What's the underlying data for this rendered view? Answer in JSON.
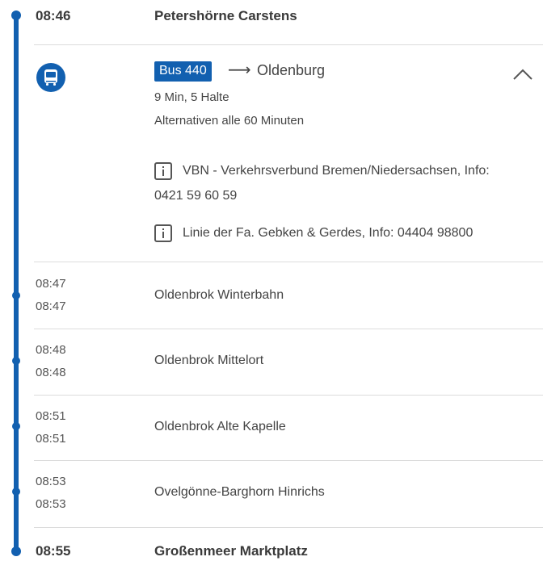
{
  "departure": {
    "time": "08:46",
    "station": "Petershörne Carstens"
  },
  "leg": {
    "icon": "bus-icon",
    "line": "Bus 440",
    "direction": "Oldenburg",
    "duration": "9 Min, 5 Halte",
    "alternatives": "Alternativen alle 60 Minuten",
    "notes": [
      {
        "icon": "info-icon",
        "line1": "VBN - Verkehrsverbund Bremen/Niedersachsen, Info:",
        "line2": "0421 59 60 59"
      },
      {
        "icon": "info-icon",
        "line1": "Linie der Fa. Gebken & Gerdes, Info: 04404 98800"
      }
    ]
  },
  "stops": [
    {
      "arr": "08:47",
      "dep": "08:47",
      "name": "Oldenbrok Winterbahn"
    },
    {
      "arr": "08:48",
      "dep": "08:48",
      "name": "Oldenbrok Mittelort"
    },
    {
      "arr": "08:51",
      "dep": "08:51",
      "name": "Oldenbrok Alte Kapelle"
    },
    {
      "arr": "08:53",
      "dep": "08:53",
      "name": "Ovelgönne-Barghorn Hinrichs"
    }
  ],
  "arrival": {
    "time": "08:55",
    "station": "Großenmeer Marktplatz"
  },
  "colors": {
    "accent": "#1260b0",
    "divider": "#dcdcdc"
  }
}
